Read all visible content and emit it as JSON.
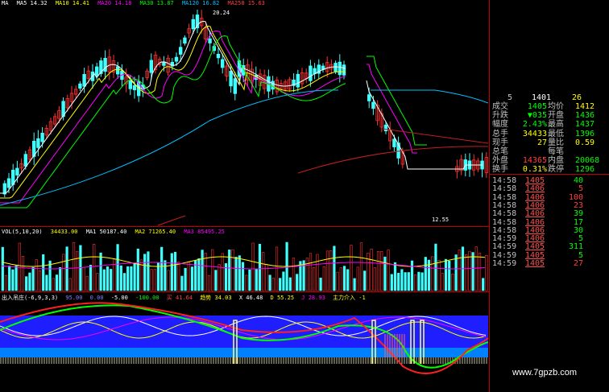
{
  "colors": {
    "up": "#ff3030",
    "down": "#40ffff",
    "ma5": "#ffffff",
    "ma10": "#ffff00",
    "ma20": "#ff00ff",
    "ma30": "#00ff00",
    "ma120": "#00c0ff",
    "ma250": "#ff2020",
    "indicator_bg": "#1e1eff"
  },
  "ma_line": {
    "ma": "MA",
    "ma5": "MA5 14.32",
    "ma10": "MA10 14.41",
    "ma20": "MA20 14.18",
    "ma30": "MA30 13.87",
    "ma120": "MA120 16.82",
    "ma250": "MA250 15.63"
  },
  "price_marks": {
    "high": "20.24",
    "low": "12.55"
  },
  "volume_line": {
    "name": "VOL(5,10,20)",
    "vol": "34433.00",
    "ma1": "MA1 50187.40",
    "ma2": "MA2 71265.40",
    "ma3": "MA3 85495.25"
  },
  "indicator_line": {
    "name": "出入吊庄(-6,9,3,3)",
    "v1": "95.00",
    "v2": "0.00",
    "v3": "-5.00",
    "v4": "-100.00",
    "v5": "买 41.64",
    "v6": "趋势 34.03",
    "v7": "X 46.48",
    "v8": "D 55.25",
    "v9": "J 28.93",
    "v10": "主力介入 -1"
  },
  "quote_panel": {
    "top": {
      "a": "5",
      "b": "1401",
      "c": "26"
    },
    "rows": [
      {
        "l1": "成交",
        "v1": "1405",
        "c1": "green",
        "l2": "均价",
        "v2": "1412",
        "c2": "yellow"
      },
      {
        "l1": "升跌",
        "v1": "▼035",
        "c1": "green",
        "l2": "开盘",
        "v2": "1436",
        "c2": "green"
      },
      {
        "l1": "幅度",
        "v1": "2.43%",
        "c1": "green",
        "l2": "最高",
        "v2": "1437",
        "c2": "green"
      },
      {
        "l1": "总手",
        "v1": "34433",
        "c1": "yellow",
        "l2": "最低",
        "v2": "1396",
        "c2": "green"
      },
      {
        "l1": "现手",
        "v1": "27",
        "c1": "yellow",
        "l2": "量比",
        "v2": "0.59",
        "c2": "yellow"
      },
      {
        "l1": "总笔",
        "v1": "",
        "c1": "yellow",
        "l2": "每笔",
        "v2": "",
        "c2": "yellow"
      },
      {
        "l1": "外盘",
        "v1": "14365",
        "c1": "red",
        "l2": "内盘",
        "v2": "20068",
        "c2": "green"
      },
      {
        "l1": "换手",
        "v1": "0.31%",
        "c1": "yellow",
        "l2": "跌停",
        "v2": "1296",
        "c2": "green"
      }
    ],
    "ticks": [
      {
        "t": "14:58",
        "p": "1405",
        "v": "40",
        "c": "green"
      },
      {
        "t": "14:58",
        "p": "1406",
        "v": "5",
        "c": "red"
      },
      {
        "t": "14:58",
        "p": "1406",
        "v": "100",
        "c": "red"
      },
      {
        "t": "14:58",
        "p": "1406",
        "v": "23",
        "c": "red"
      },
      {
        "t": "14:58",
        "p": "1406",
        "v": "39",
        "c": "green"
      },
      {
        "t": "14:58",
        "p": "1406",
        "v": "17",
        "c": "green"
      },
      {
        "t": "14:58",
        "p": "1406",
        "v": "30",
        "c": "green"
      },
      {
        "t": "14:59",
        "p": "1406",
        "v": "5",
        "c": "green"
      },
      {
        "t": "14:59",
        "p": "1405",
        "v": "311",
        "c": "green"
      },
      {
        "t": "14:59",
        "p": "1405",
        "v": "5",
        "c": "green"
      },
      {
        "t": "14:59",
        "p": "1405",
        "v": "27",
        "c": "red"
      }
    ]
  },
  "watermark": "www.7gpzb.com"
}
